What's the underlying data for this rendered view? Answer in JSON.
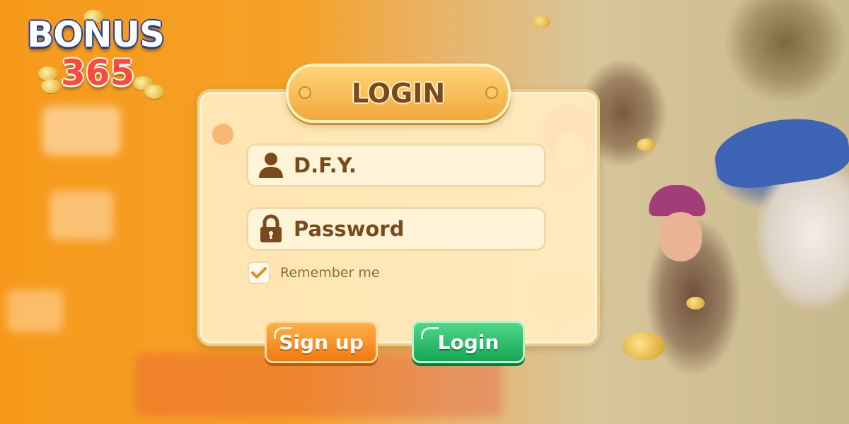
{
  "brand": {
    "logo_word": "BONUS",
    "logo_number": "365"
  },
  "login_panel": {
    "title": "LOGIN",
    "username_value": "D.F.Y.",
    "password_placeholder": "Password",
    "remember_label": "Remember me",
    "remember_checked": true,
    "signup_label": "Sign up",
    "login_label": "Login"
  },
  "icons": {
    "username": "user-icon",
    "password": "lock-icon",
    "remember": "checkmark-icon"
  },
  "colors": {
    "background_orange": "#f79a1c",
    "panel_bg": "#ffecbe",
    "text_brown": "#7a4a1c",
    "signup_orange": "#f07a0e",
    "login_green": "#15a653",
    "check_orange": "#f08a12"
  }
}
